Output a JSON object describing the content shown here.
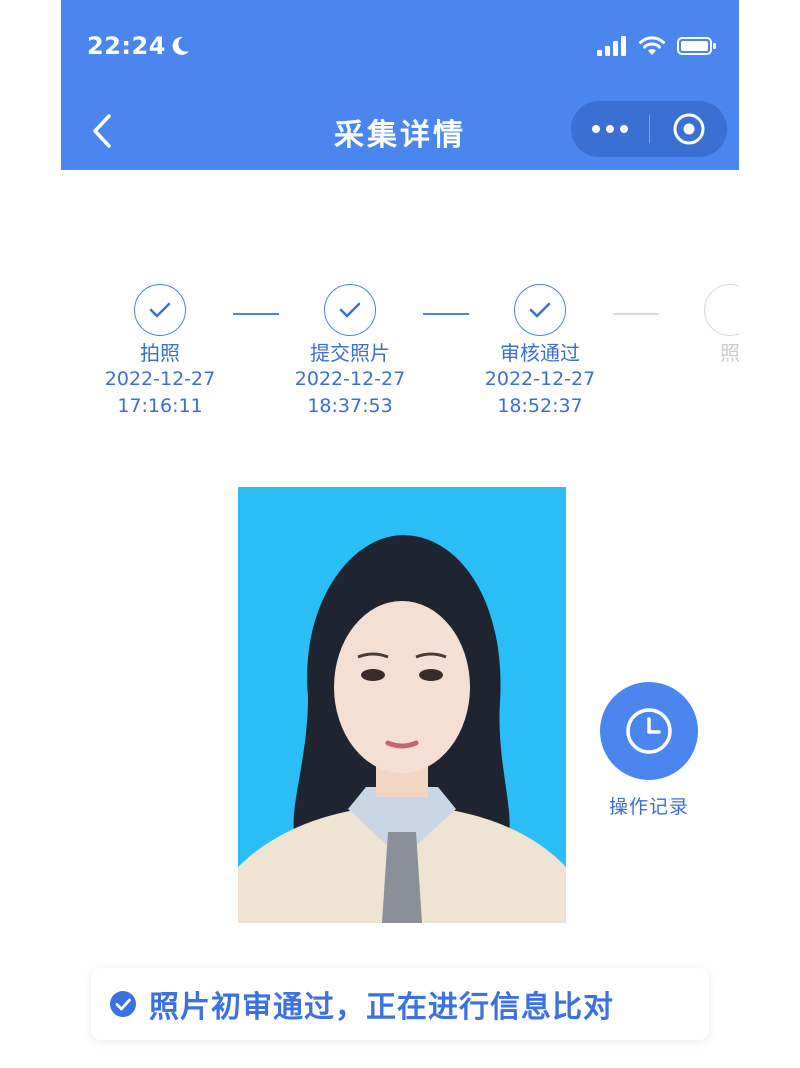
{
  "status_bar": {
    "time": "22:24",
    "icons": [
      "moon-icon",
      "cellular-signal-icon",
      "wifi-icon",
      "battery-icon"
    ]
  },
  "nav": {
    "title": "采集详情",
    "back_icon": "chevron-left-icon",
    "more_icon": "more-dots-icon",
    "close_icon": "target-close-icon"
  },
  "steps": [
    {
      "label": "拍照",
      "date": "2022-12-27",
      "time": "17:16:11",
      "done": true
    },
    {
      "label": "提交照片",
      "date": "2022-12-27",
      "time": "18:37:53",
      "done": true
    },
    {
      "label": "审核通过",
      "date": "2022-12-27",
      "time": "18:52:37",
      "done": true
    },
    {
      "label": "照",
      "done": false
    }
  ],
  "history": {
    "label": "操作记录",
    "icon": "clock-icon"
  },
  "status_message": {
    "text": "照片初审通过，正在进行信息比对",
    "icon": "check-circle-icon"
  },
  "colors": {
    "primary": "#4a86ee",
    "photo_background": "#2bbdf5",
    "step_text": "#3b6fd6"
  }
}
